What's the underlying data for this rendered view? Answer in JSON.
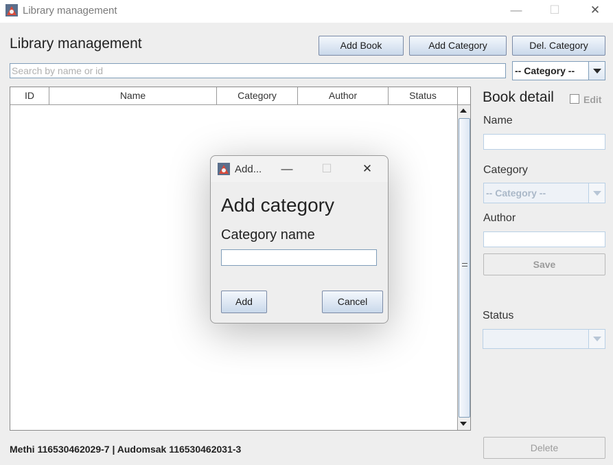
{
  "window": {
    "title": "Library management",
    "controls": {
      "minimize": "—",
      "maximize": "☐",
      "close": "✕"
    }
  },
  "header": {
    "title": "Library management",
    "buttons": {
      "add_book": "Add Book",
      "add_category": "Add Category",
      "del_category": "Del. Category"
    }
  },
  "search": {
    "placeholder": "Search by name or id",
    "category_filter": "-- Category --"
  },
  "table": {
    "columns": [
      "ID",
      "Name",
      "Category",
      "Author",
      "Status"
    ],
    "rows": []
  },
  "detail": {
    "title": "Book detail",
    "edit_label": "Edit",
    "edit_checked": false,
    "name_label": "Name",
    "name_value": "",
    "category_label": "Category",
    "category_value": "-- Category --",
    "author_label": "Author",
    "author_value": "",
    "save_label": "Save",
    "status_label": "Status",
    "status_value": "",
    "delete_label": "Delete"
  },
  "footer": {
    "credits": "Methi 116530462029-7 | Audomsak 116530462031-3"
  },
  "dialog": {
    "window_title": "Add...",
    "heading": "Add category",
    "field_label": "Category name",
    "field_value": "",
    "add_label": "Add",
    "cancel_label": "Cancel"
  },
  "colors": {
    "button_border": "#7a8aa6",
    "field_border": "#7f9db9",
    "background": "#eeeeee"
  }
}
